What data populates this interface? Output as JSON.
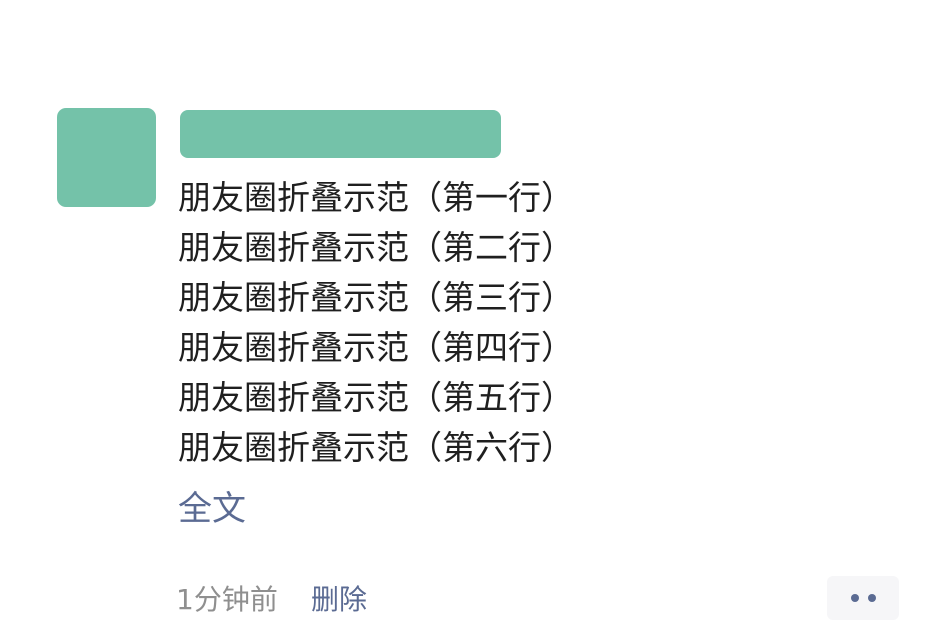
{
  "post": {
    "avatar_color": "#74c2a9",
    "author_name_redacted_color": "#74c2a9",
    "lines": [
      "朋友圈折叠示范（第一行）",
      "朋友圈折叠示范（第二行）",
      "朋友圈折叠示范（第三行）",
      "朋友圈折叠示范（第四行）",
      "朋友圈折叠示范（第五行）",
      "朋友圈折叠示范（第六行）"
    ],
    "expand_label": "全文",
    "link_color": "#5b6b93"
  },
  "footer": {
    "time": "1分钟前",
    "delete_label": "删除",
    "more_icon": "more-dots-icon"
  }
}
